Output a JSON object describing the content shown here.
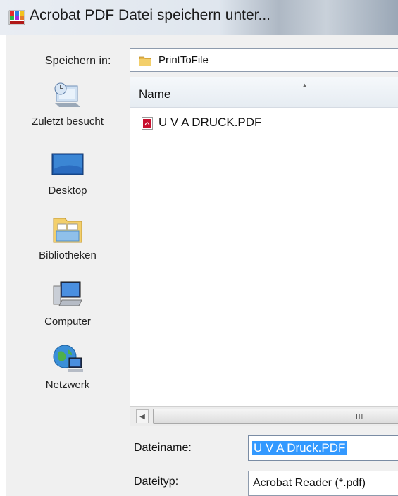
{
  "window": {
    "title": "Acrobat PDF Datei speichern unter..."
  },
  "lookin": {
    "label": "Speichern in:",
    "value": "PrintToFile"
  },
  "places": [
    {
      "label": "Zuletzt besucht",
      "icon": "recent-places-icon"
    },
    {
      "label": "Desktop",
      "icon": "desktop-icon"
    },
    {
      "label": "Bibliotheken",
      "icon": "libraries-icon"
    },
    {
      "label": "Computer",
      "icon": "computer-icon"
    },
    {
      "label": "Netzwerk",
      "icon": "network-icon"
    }
  ],
  "filelist": {
    "column_header": "Name",
    "files": [
      {
        "name": "U V A  DRUCK.PDF",
        "icon": "pdf-file-icon"
      }
    ]
  },
  "scrollbar": {
    "grip": "III"
  },
  "filename": {
    "label": "Dateiname:",
    "value": "U V A  Druck.PDF"
  },
  "filetype": {
    "label": "Dateityp:",
    "value": "Acrobat Reader (*.pdf)"
  },
  "colors": {
    "selection": "#3399ff",
    "pdf_red": "#c8102e",
    "folder_yellow": "#e8b84a"
  }
}
